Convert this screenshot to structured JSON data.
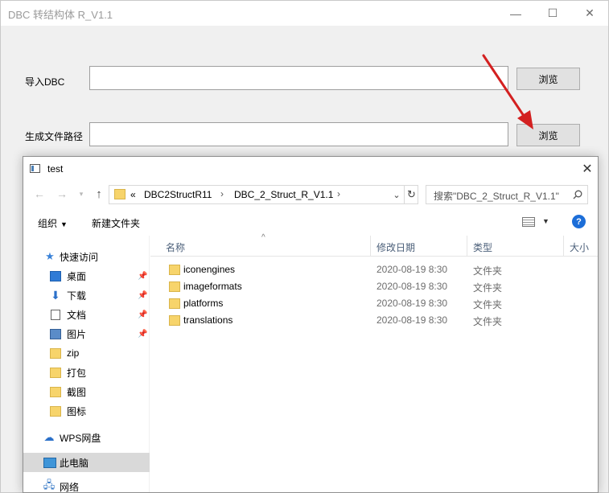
{
  "main_window": {
    "title": "DBC 转结构体 R_V1.1",
    "controls": {
      "minimize": "—",
      "maximize": "☐",
      "close": "✕"
    },
    "import_label": "导入DBC",
    "import_value": "",
    "output_label": "生成文件路径",
    "output_value": "",
    "browse_label": "浏览"
  },
  "dialog": {
    "title": "test",
    "address": {
      "prefix": "«",
      "segments": [
        "DBC2StructR11",
        "DBC_2_Struct_R_V1.1"
      ]
    },
    "search_placeholder": "搜索\"DBC_2_Struct_R_V1.1\"",
    "toolbar": {
      "organize": "组织",
      "new_folder": "新建文件夹"
    },
    "nav": {
      "quick_access": "快速访问",
      "items": [
        "桌面",
        "下载",
        "文档",
        "图片",
        "zip",
        "打包",
        "截图",
        "图标"
      ],
      "wps": "WPS网盘",
      "this_pc": "此电脑",
      "network": "网络"
    },
    "columns": [
      "名称",
      "修改日期",
      "类型",
      "大小"
    ],
    "files": [
      {
        "name": "iconengines",
        "date": "2020-08-19 8:30",
        "type": "文件夹"
      },
      {
        "name": "imageformats",
        "date": "2020-08-19 8:30",
        "type": "文件夹"
      },
      {
        "name": "platforms",
        "date": "2020-08-19 8:30",
        "type": "文件夹"
      },
      {
        "name": "translations",
        "date": "2020-08-19 8:30",
        "type": "文件夹"
      }
    ]
  },
  "colors": {
    "accent": "#1c6ed8",
    "arrow": "#d32020",
    "folder": "#f7d46b"
  }
}
